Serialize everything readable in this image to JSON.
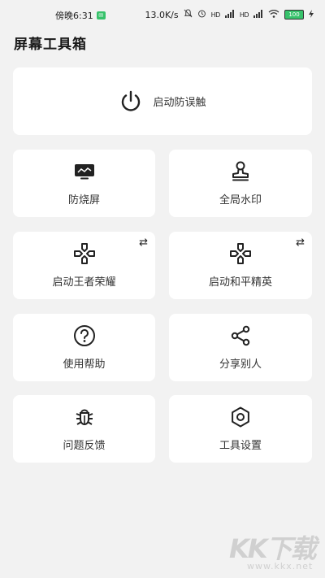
{
  "status_bar": {
    "time": "傍晚6:31",
    "network_speed": "13.0K/s",
    "signal_label_1": "HD",
    "signal_label_2": "HD",
    "battery": "100"
  },
  "app": {
    "title": "屏幕工具箱"
  },
  "big_card": {
    "label": "启动防误触",
    "icon": "power-icon"
  },
  "cards": [
    {
      "label": "防烧屏",
      "icon": "monitor-icon",
      "swap": false
    },
    {
      "label": "全局水印",
      "icon": "stamp-icon",
      "swap": false
    },
    {
      "label": "启动王者荣耀",
      "icon": "gamepad-icon",
      "swap": true
    },
    {
      "label": "启动和平精英",
      "icon": "gamepad-icon",
      "swap": true
    },
    {
      "label": "使用帮助",
      "icon": "help-icon",
      "swap": false
    },
    {
      "label": "分享别人",
      "icon": "share-icon",
      "swap": false
    },
    {
      "label": "问题反馈",
      "icon": "bug-icon",
      "swap": false
    },
    {
      "label": "工具设置",
      "icon": "settings-icon",
      "swap": false
    }
  ],
  "swap_glyph": "⇄",
  "watermark": {
    "logo": "KK下载",
    "url": "www.kkx.net"
  }
}
